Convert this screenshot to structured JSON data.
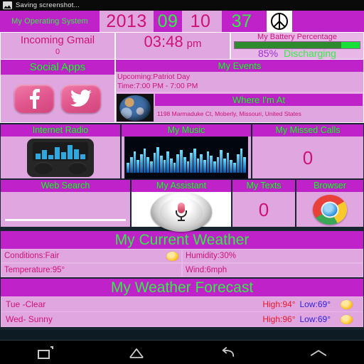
{
  "statusbar": {
    "icon": "screenshot-icon",
    "text": "Saving screenshot..."
  },
  "os_widget": {
    "title": "My Operating System",
    "year": "2013",
    "month": "09",
    "day": "10",
    "extra": "37",
    "peace_icon": "peace-icon"
  },
  "gmail": {
    "title": "Incoming Gmail",
    "count": "0"
  },
  "clock": {
    "time": "03:48",
    "meridiem": "pm"
  },
  "battery": {
    "title": "My Battery Percentage",
    "percent_label": "85%",
    "percent_value": 85,
    "status": "Discharging"
  },
  "social": {
    "title": "Social Apps",
    "apps": [
      {
        "name": "facebook-icon",
        "label": "Facebook"
      },
      {
        "name": "twitter-icon",
        "label": "Twitter"
      }
    ]
  },
  "events": {
    "title": "My Events",
    "upcoming": "Upcoming:Patriot Day",
    "time": "Time:7:00 PM - 7:00 PM"
  },
  "location": {
    "title": "Where I'm At",
    "address": "1198 Marmaduke Ct, Moberly, Missouri, United States",
    "thumb": "earth-image"
  },
  "apps": {
    "row1": [
      {
        "title": "Internet Radio",
        "icon": "radio-icon"
      },
      {
        "title": "My Music",
        "icon": "equalizer-image"
      },
      {
        "title": "My Missed Calls",
        "value": "0"
      }
    ],
    "row2": [
      {
        "title": "Web Search",
        "placeholder": ""
      },
      {
        "title": "My Assistant",
        "icon": "microphone-icon"
      },
      {
        "title": "My Texts",
        "value": "0"
      },
      {
        "title": "Browser",
        "icon": "chrome-icon"
      }
    ]
  },
  "current_weather": {
    "title": "My Current Weather",
    "conditions": "Conditions:Fair",
    "humidity": "Humidity:30%",
    "temperature": "Temperature:95°",
    "wind": "Wind:6mph",
    "icon": "sun-icon"
  },
  "forecast": {
    "title": "My Weather Forecast",
    "days": [
      {
        "day": "Tue  -Clear",
        "high": "High:94°",
        "low": "Low:69°",
        "icon": "sun-icon"
      },
      {
        "day": "Wed- Sunny",
        "high": "High:96°",
        "low": "Low:69°",
        "icon": "sun-icon"
      }
    ]
  },
  "navbar": {
    "buttons": [
      {
        "name": "recents-icon",
        "label": "Recents"
      },
      {
        "name": "home-icon",
        "label": "Home"
      },
      {
        "name": "back-icon",
        "label": "Back"
      },
      {
        "name": "chevron-up-icon",
        "label": "Expand"
      }
    ]
  },
  "colors": {
    "accent_purple": "#bf22c8",
    "panel_pink": "#e0a6e0",
    "page_pink": "#e8b7e8",
    "green_text": "#33ee44",
    "pink_text": "#cc1277",
    "dark_band": "#16252f",
    "high_red": "#e8192a",
    "low_blue": "#2e22d8"
  }
}
